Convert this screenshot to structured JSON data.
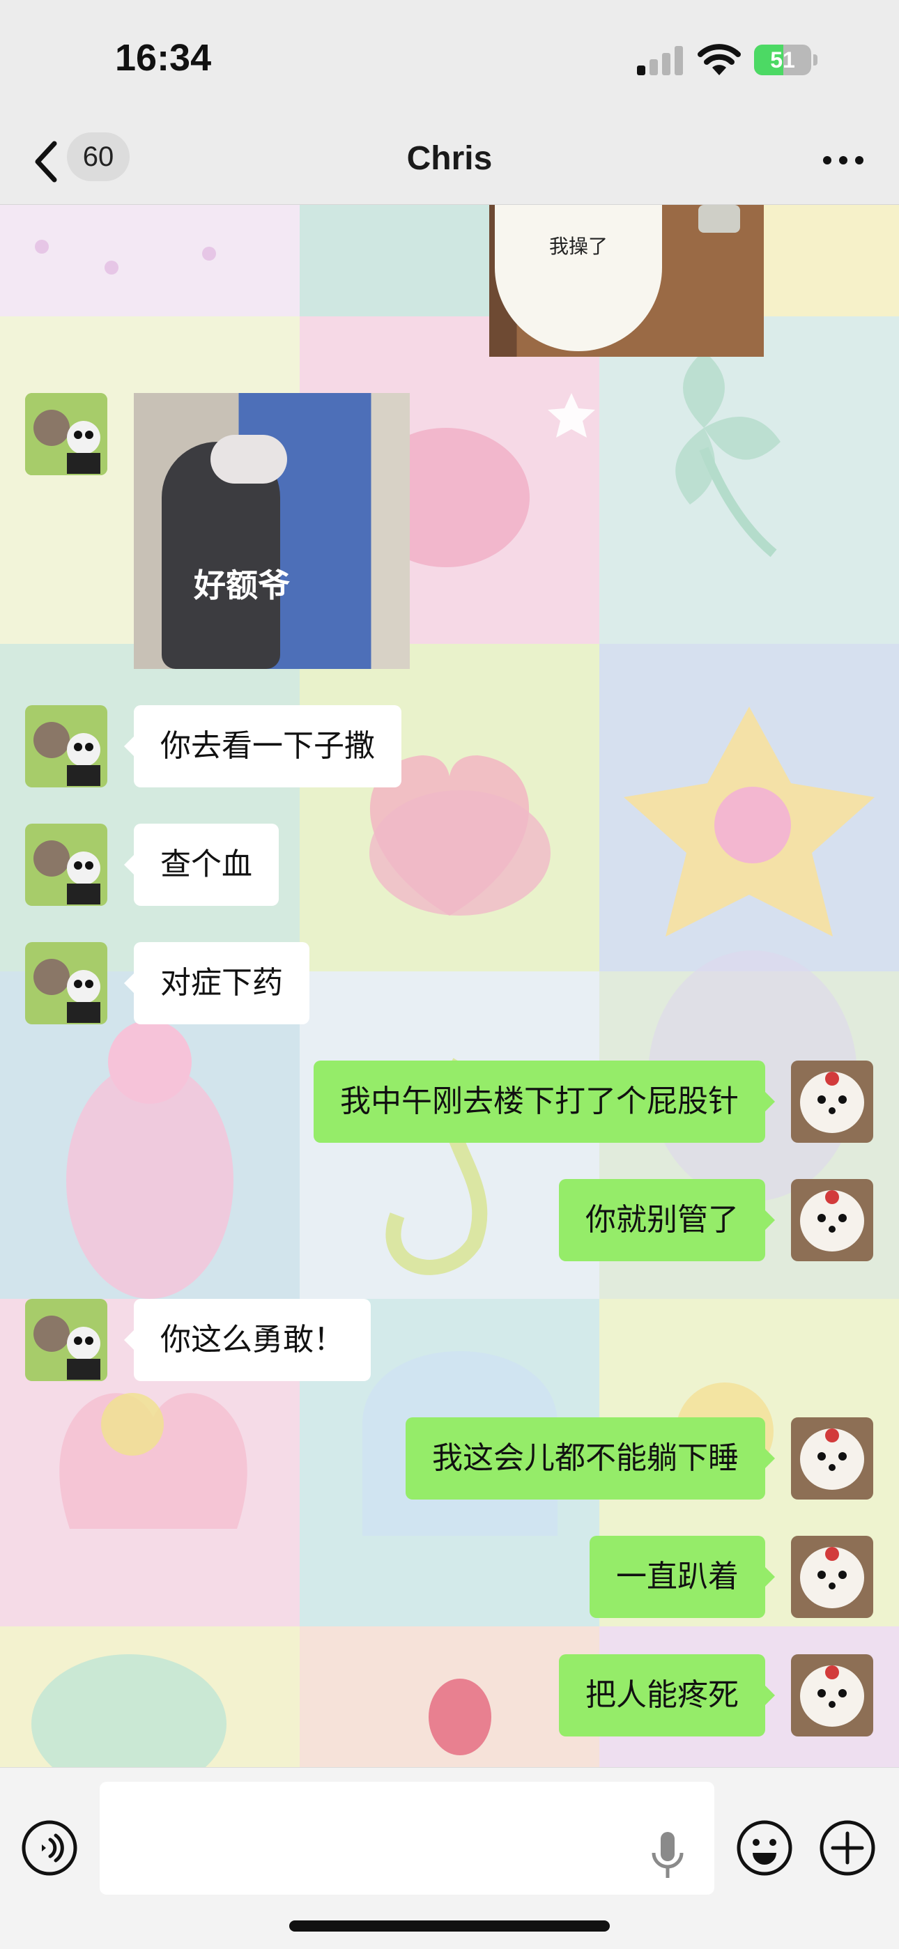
{
  "status_bar": {
    "time": "16:34",
    "battery_percent": "51",
    "battery_level": 0.51,
    "cellular_bars_active": 1
  },
  "nav": {
    "unread_count": "60",
    "title": "Chris",
    "icons": {
      "back": "chevron-left-icon",
      "more": "more-dots-icon"
    }
  },
  "stickers": {
    "top_partial_caption": "我操了",
    "opossum_caption": "好额爷"
  },
  "messages": [
    {
      "side": "in",
      "text": "你去看一下子撒"
    },
    {
      "side": "in",
      "text": "查个血"
    },
    {
      "side": "in",
      "text": "对症下药"
    },
    {
      "side": "out",
      "text": "我中午刚去楼下打了个屁股针"
    },
    {
      "side": "out",
      "text": "你就别管了"
    },
    {
      "side": "in",
      "text": "你这么勇敢！"
    },
    {
      "side": "out",
      "text": "我这会儿都不能躺下睡"
    },
    {
      "side": "out",
      "text": "一直趴着"
    },
    {
      "side": "out",
      "text": "把人能疼死"
    }
  ],
  "input_bar": {
    "placeholder": "",
    "icons": {
      "voice": "voice-icon",
      "mic": "microphone-icon",
      "emoji": "emoji-icon",
      "plus": "plus-icon"
    }
  },
  "colors": {
    "bubble_out": "#95ec69",
    "bubble_in": "#ffffff",
    "battery_fill": "#4cd964"
  }
}
